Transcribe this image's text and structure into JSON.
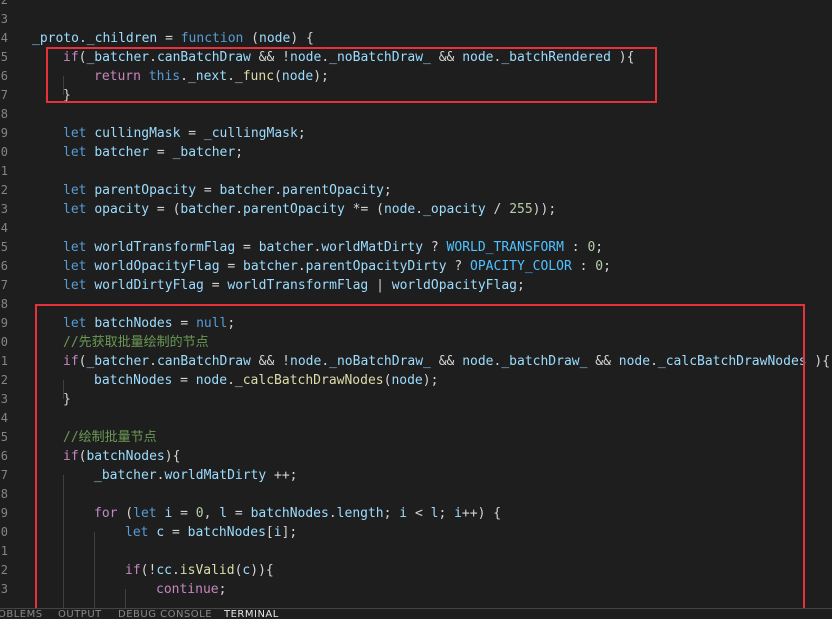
{
  "editor": {
    "line_numbers": [
      "2",
      "3",
      "4",
      "5",
      "6",
      "7",
      "8",
      "9",
      "0",
      "1",
      "2",
      "3",
      "4",
      "5",
      "6",
      "7",
      "8",
      "9",
      "0",
      "1",
      "2",
      "3",
      "4",
      "5",
      "6",
      "7",
      "8",
      "9",
      "0",
      "1",
      "2",
      "3"
    ],
    "code": {
      "l4": {
        "a": "_proto.",
        "b": "_children",
        "c": " = ",
        "d": "function",
        "e": " (",
        "f": "node",
        "g": ") {"
      },
      "l5": {
        "a": "if",
        "b": "(",
        "c": "_batcher",
        "d": ".",
        "e": "canBatchDraw",
        "f": " && !",
        "g": "node",
        "h": ".",
        "i": "_noBatchDraw_",
        "j": " && ",
        "k": "node",
        "l": ".",
        "m": "_batchRendered",
        "n": " ){"
      },
      "l6": {
        "a": "return",
        "b": " ",
        "c": "this",
        "d": ".",
        "e": "_next",
        "f": ".",
        "g": "_func",
        "h": "(",
        "i": "node",
        "j": ");"
      },
      "l7": {
        "a": "}"
      },
      "l9": {
        "a": "let",
        "b": " ",
        "c": "cullingMask",
        "d": " = ",
        "e": "_cullingMask",
        "f": ";"
      },
      "l10": {
        "a": "let",
        "b": " ",
        "c": "batcher",
        "d": " = ",
        "e": "_batcher",
        "f": ";"
      },
      "l12": {
        "a": "let",
        "b": " ",
        "c": "parentOpacity",
        "d": " = ",
        "e": "batcher",
        "f": ".",
        "g": "parentOpacity",
        "h": ";"
      },
      "l13": {
        "a": "let",
        "b": " ",
        "c": "opacity",
        "d": " = (",
        "e": "batcher",
        "f": ".",
        "g": "parentOpacity",
        "h": " *= (",
        "i": "node",
        "j": ".",
        "k": "_opacity",
        "l": " / ",
        "m": "255",
        "n": "));"
      },
      "l15": {
        "a": "let",
        "b": " ",
        "c": "worldTransformFlag",
        "d": " = ",
        "e": "batcher",
        "f": ".",
        "g": "worldMatDirty",
        "h": " ? ",
        "i": "WORLD_TRANSFORM",
        "j": " : ",
        "k": "0",
        "l": ";"
      },
      "l16": {
        "a": "let",
        "b": " ",
        "c": "worldOpacityFlag",
        "d": " = ",
        "e": "batcher",
        "f": ".",
        "g": "parentOpacityDirty",
        "h": " ? ",
        "i": "OPACITY_COLOR",
        "j": " : ",
        "k": "0",
        "l": ";"
      },
      "l17": {
        "a": "let",
        "b": " ",
        "c": "worldDirtyFlag",
        "d": " = ",
        "e": "worldTransformFlag",
        "f": " | ",
        "g": "worldOpacityFlag",
        "h": ";"
      },
      "l19": {
        "a": "let",
        "b": " ",
        "c": "batchNodes",
        "d": " = ",
        "e": "null",
        "f": ";"
      },
      "l20": {
        "a": "//先获取批量绘制的节点"
      },
      "l21": {
        "a": "if",
        "b": "(",
        "c": "_batcher",
        "d": ".",
        "e": "canBatchDraw",
        "f": " && !",
        "g": "node",
        "h": ".",
        "i": "_noBatchDraw_",
        "j": " && ",
        "k": "node",
        "l": ".",
        "m": "_batchDraw_",
        "n": " && ",
        "o": "node",
        "p": ".",
        "q": "_calcBatchDrawNodes",
        "r": " ){"
      },
      "l22": {
        "a": "batchNodes",
        "b": " = ",
        "c": "node",
        "d": ".",
        "e": "_calcBatchDrawNodes",
        "f": "(",
        "g": "node",
        "h": ");"
      },
      "l23": {
        "a": "}"
      },
      "l25": {
        "a": "//绘制批量节点"
      },
      "l26": {
        "a": "if",
        "b": "(",
        "c": "batchNodes",
        "d": "){"
      },
      "l27": {
        "a": "_batcher",
        "b": ".",
        "c": "worldMatDirty",
        "d": " ++;"
      },
      "l29": {
        "a": "for",
        "b": " (",
        "c": "let",
        "d": " ",
        "e": "i",
        "f": " = ",
        "g": "0",
        "h": ", ",
        "i": "l",
        "j": " = ",
        "k": "batchNodes",
        "l": ".",
        "m": "length",
        "n": "; ",
        "o": "i",
        "p": " < ",
        "q": "l",
        "r": "; ",
        "s": "i",
        "t": "++) {"
      },
      "l30": {
        "a": "let",
        "b": " ",
        "c": "c",
        "d": " = ",
        "e": "batchNodes",
        "f": "[",
        "g": "i",
        "h": "];"
      },
      "l32": {
        "a": "if",
        "b": "(!",
        "c": "cc",
        "d": ".",
        "e": "isValid",
        "f": "(",
        "g": "c",
        "h": ")){"
      },
      "l33": {
        "a": "continue",
        "b": ";"
      }
    }
  },
  "panel": {
    "tabs": [
      "OBLEMS",
      "OUTPUT",
      "DEBUG CONSOLE",
      "TERMINAL"
    ],
    "active": "TERMINAL"
  },
  "colors": {
    "highlight_box": "#e5323b",
    "background": "#1e1e1e"
  }
}
